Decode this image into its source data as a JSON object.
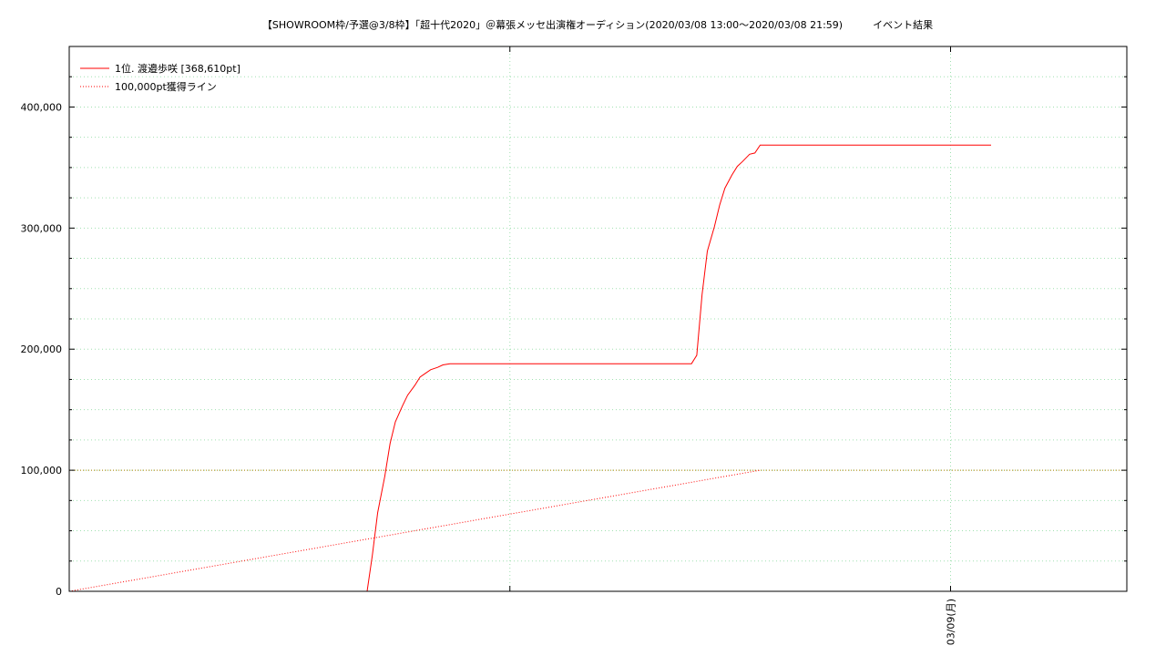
{
  "chart_data": {
    "type": "line",
    "title": "【SHOWROOM枠/予選@3/8枠】「超十代2020」＠幕張メッセ出演権オーディション(2020/03/08 13:00～2020/03/08 21:59)　　　イベント結果",
    "xlabel": "",
    "ylabel": "",
    "xlim": [
      0,
      600
    ],
    "ylim": [
      0,
      450000
    ],
    "y_ticks": [
      0,
      100000,
      200000,
      300000,
      400000
    ],
    "y_tick_labels": [
      "0",
      "100,000",
      "200,000",
      "300,000",
      "400,000"
    ],
    "x_ticks": [
      500
    ],
    "x_tick_labels": [
      "03/09(月)"
    ],
    "x_grid_major": [
      250,
      500
    ],
    "y_grid_minor": [
      25000,
      50000,
      75000,
      125000,
      150000,
      175000,
      225000,
      250000,
      275000,
      325000,
      350000,
      375000,
      425000
    ],
    "grid": true,
    "legend_position": "top-left",
    "series": [
      {
        "name": "1位. 渡邉歩咲 [368,610pt]",
        "color": "#ff0000",
        "style": "solid",
        "x": [
          169,
          172,
          175,
          179,
          182,
          185,
          189,
          192,
          196,
          199,
          202,
          205,
          209,
          212,
          216,
          219,
          222,
          226,
          232,
          239,
          245,
          252,
          259,
          265,
          272,
          279,
          286,
          292,
          299,
          306,
          312,
          319,
          326,
          332,
          339,
          346,
          353,
          356,
          359,
          362,
          366,
          369,
          372,
          376,
          379,
          382,
          386,
          389,
          392,
          396,
          399,
          402,
          406,
          409,
          412,
          416,
          422,
          429,
          436,
          443,
          449,
          456,
          463,
          469,
          476,
          483,
          489,
          496,
          503,
          509,
          516,
          523
        ],
        "y": [
          0,
          30000,
          65000,
          95000,
          122000,
          140000,
          153000,
          162000,
          170000,
          177000,
          180000,
          183000,
          185000,
          187000,
          188000,
          188000,
          188000,
          188000,
          188000,
          188000,
          188000,
          188000,
          188000,
          188000,
          188000,
          188000,
          188000,
          188000,
          188000,
          188000,
          188000,
          188000,
          188000,
          188000,
          188000,
          188000,
          188000,
          195000,
          245000,
          281000,
          301000,
          319000,
          333000,
          344000,
          351000,
          355000,
          361000,
          362000,
          368610,
          368610,
          368610,
          368610,
          368610,
          368610,
          368610,
          368610,
          368610,
          368610,
          368610,
          368610,
          368610,
          368610,
          368610,
          368610,
          368610,
          368610,
          368610,
          368610,
          368610,
          368610,
          368610,
          368610
        ]
      },
      {
        "name": "100,000pt獲得ライン",
        "color": "#ff0000",
        "style": "dotted",
        "x": [
          0,
          392
        ],
        "y": [
          0,
          100000
        ]
      }
    ]
  }
}
